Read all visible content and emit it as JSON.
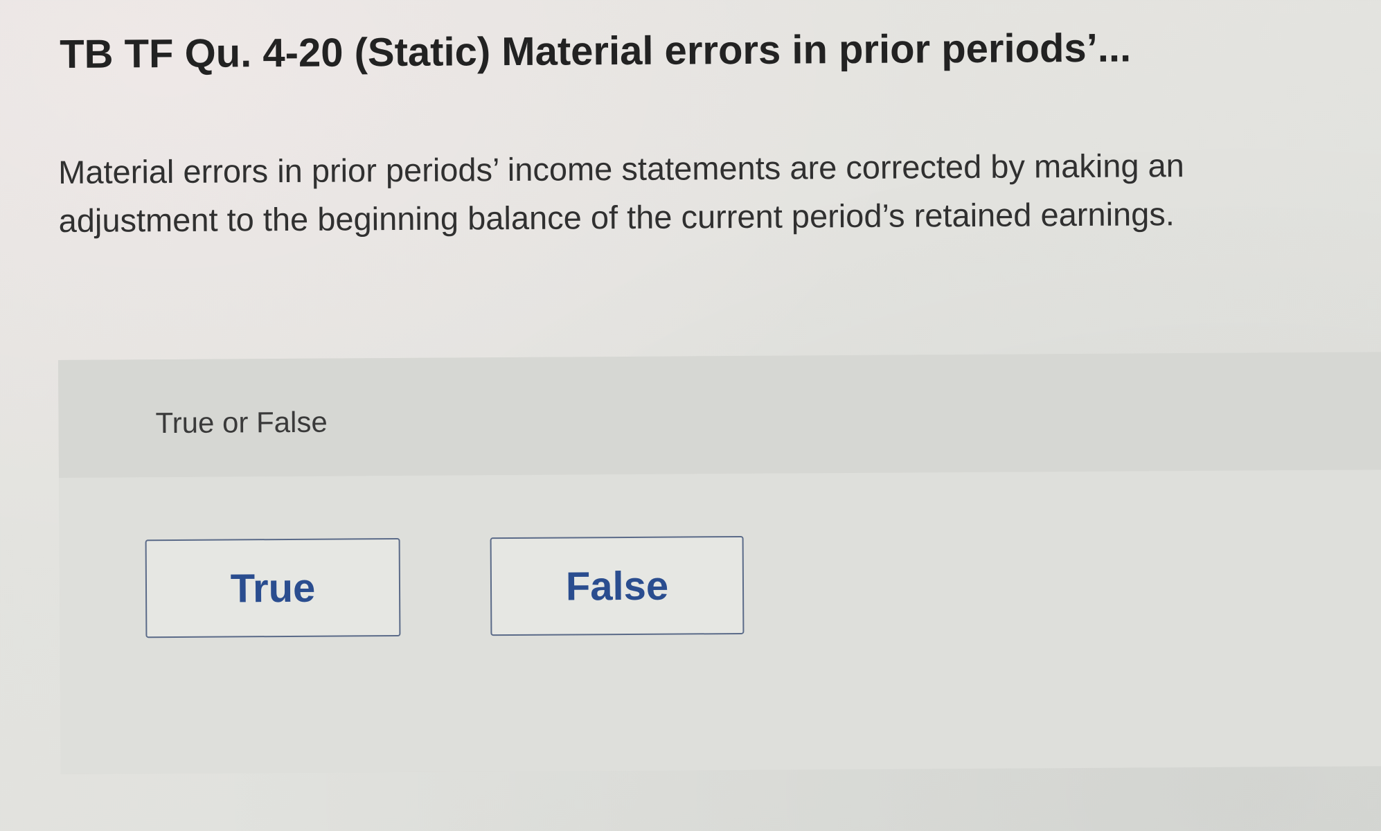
{
  "question": {
    "title": "TB TF Qu. 4-20 (Static) Material errors in prior periods’...",
    "prompt": "Material errors in prior periods’ income statements are corrected by making an adjustment to the beginning balance of the current period’s retained earnings."
  },
  "answer": {
    "type_label": "True or False",
    "choices": [
      {
        "label": "True"
      },
      {
        "label": "False"
      }
    ]
  },
  "colors": {
    "background": "#e3e3df",
    "panel": "#d9dad6",
    "button_border": "#5a6a88",
    "button_text": "#2a4d8f"
  }
}
